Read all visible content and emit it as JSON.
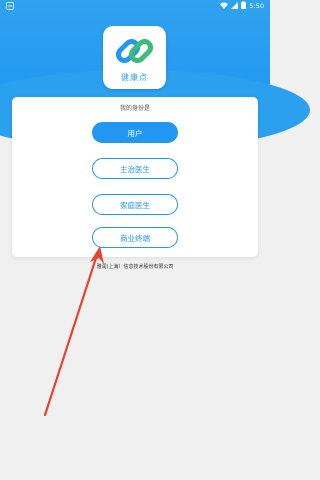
{
  "status_bar": {
    "time": "5:50",
    "icons": [
      "app-icon",
      "wifi-icon",
      "cellular-icon",
      "battery-icon"
    ]
  },
  "app": {
    "name": "健康点",
    "logo_icon": "chain-link-icon",
    "brand_color": "#2196f3",
    "logo_green": "#3dbb7a"
  },
  "identity_card": {
    "title": "我的身份是",
    "roles": [
      {
        "label": "用户",
        "selected": true
      },
      {
        "label": "主治医生",
        "selected": false
      },
      {
        "label": "家庭医生",
        "selected": false
      },
      {
        "label": "商业终端",
        "selected": false
      }
    ]
  },
  "footer": {
    "company": "雅润(上海）信息技术股份有限公司"
  },
  "annotation": {
    "arrow_color": "#e5452f"
  }
}
